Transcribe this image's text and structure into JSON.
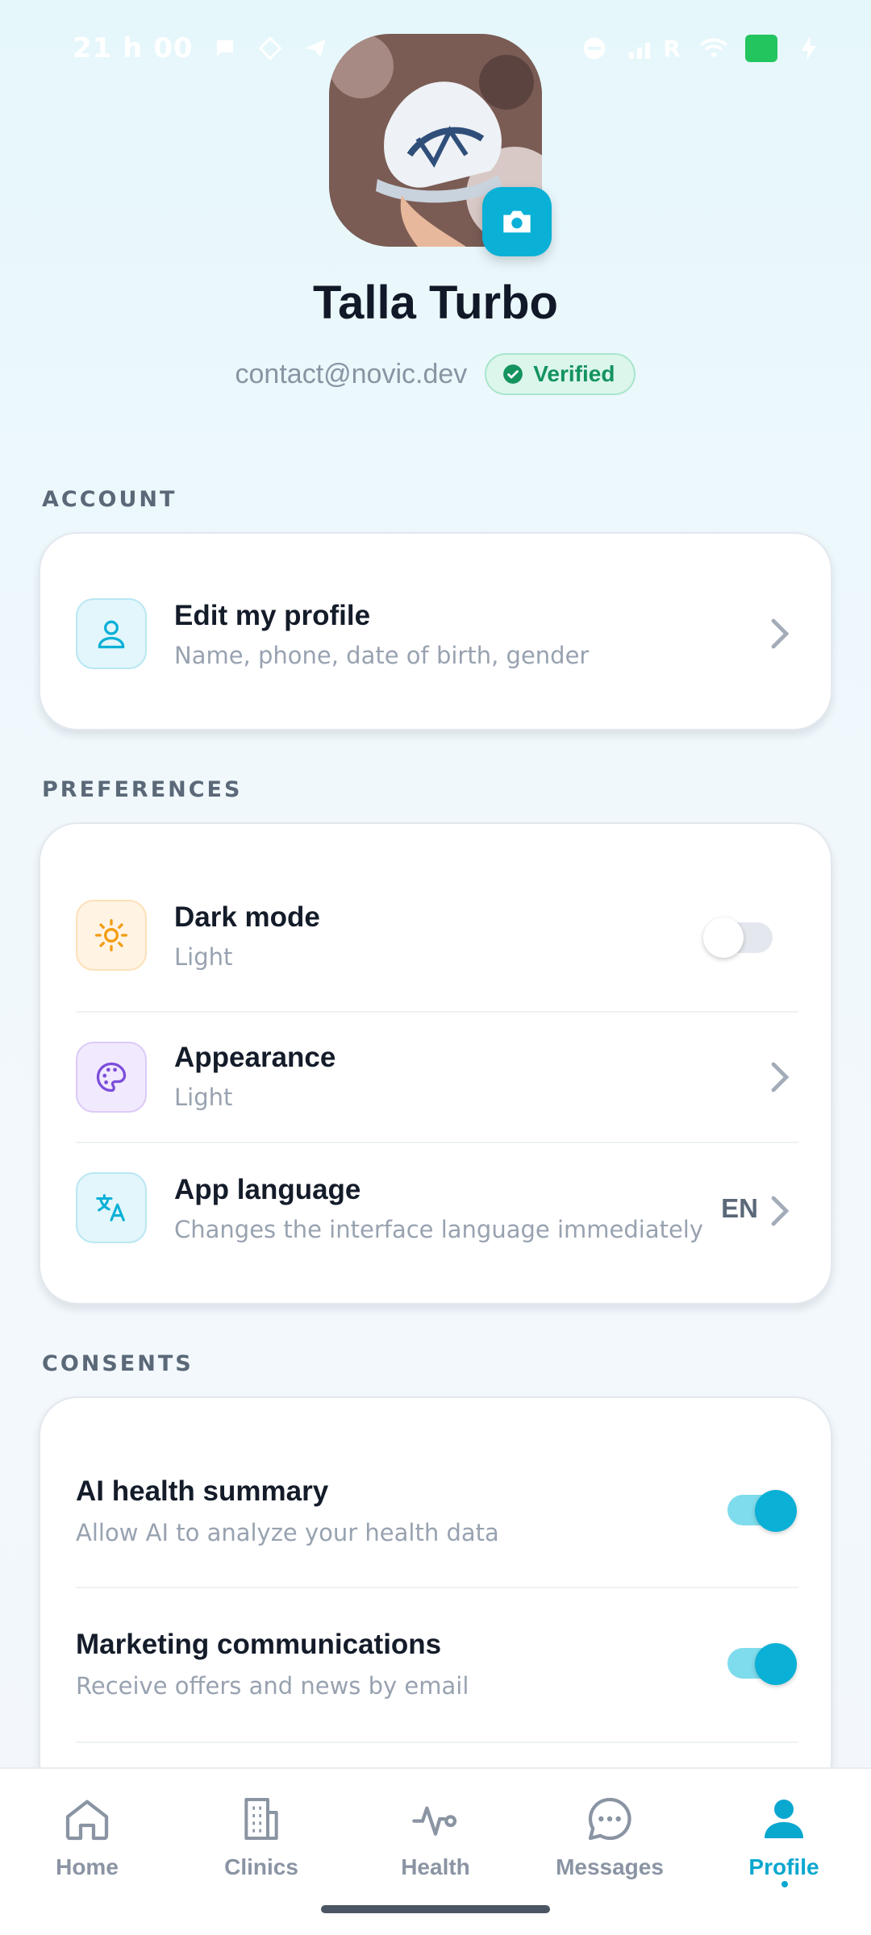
{
  "status_bar": {
    "time": "21 h 00",
    "network": "R"
  },
  "profile": {
    "name": "Talla Turbo",
    "email": "contact@novic.dev",
    "verified_label": "Verified"
  },
  "sections": {
    "account": "ACCOUNT",
    "preferences": "PREFERENCES",
    "consents": "CONSENTS"
  },
  "account": {
    "edit_profile": {
      "title": "Edit my profile",
      "subtitle": "Name, phone, date of birth, gender",
      "icon": "user-icon"
    }
  },
  "preferences": {
    "dark_mode": {
      "title": "Dark mode",
      "subtitle": "Light",
      "enabled": false,
      "icon": "sun-icon"
    },
    "appearance": {
      "title": "Appearance",
      "subtitle": "Light",
      "icon": "palette-icon"
    },
    "language": {
      "title": "App language",
      "subtitle": "Changes the interface language immediately",
      "value": "EN",
      "icon": "translate-icon"
    }
  },
  "consents": {
    "ai_summary": {
      "title": "AI health summary",
      "subtitle": "Allow AI to analyze your health data",
      "enabled": true
    },
    "marketing": {
      "title": "Marketing communications",
      "subtitle": "Receive offers and news by email",
      "enabled": true
    }
  },
  "nav": {
    "items": [
      {
        "label": "Home",
        "icon": "home-icon"
      },
      {
        "label": "Clinics",
        "icon": "building-icon"
      },
      {
        "label": "Health",
        "icon": "pulse-icon"
      },
      {
        "label": "Messages",
        "icon": "chat-icon"
      },
      {
        "label": "Profile",
        "icon": "profile-icon",
        "active": true
      }
    ]
  },
  "colors": {
    "accent": "#0ab0d6",
    "verified": "#14935f",
    "text_primary": "#141c2a",
    "text_secondary": "#98a2b0"
  }
}
